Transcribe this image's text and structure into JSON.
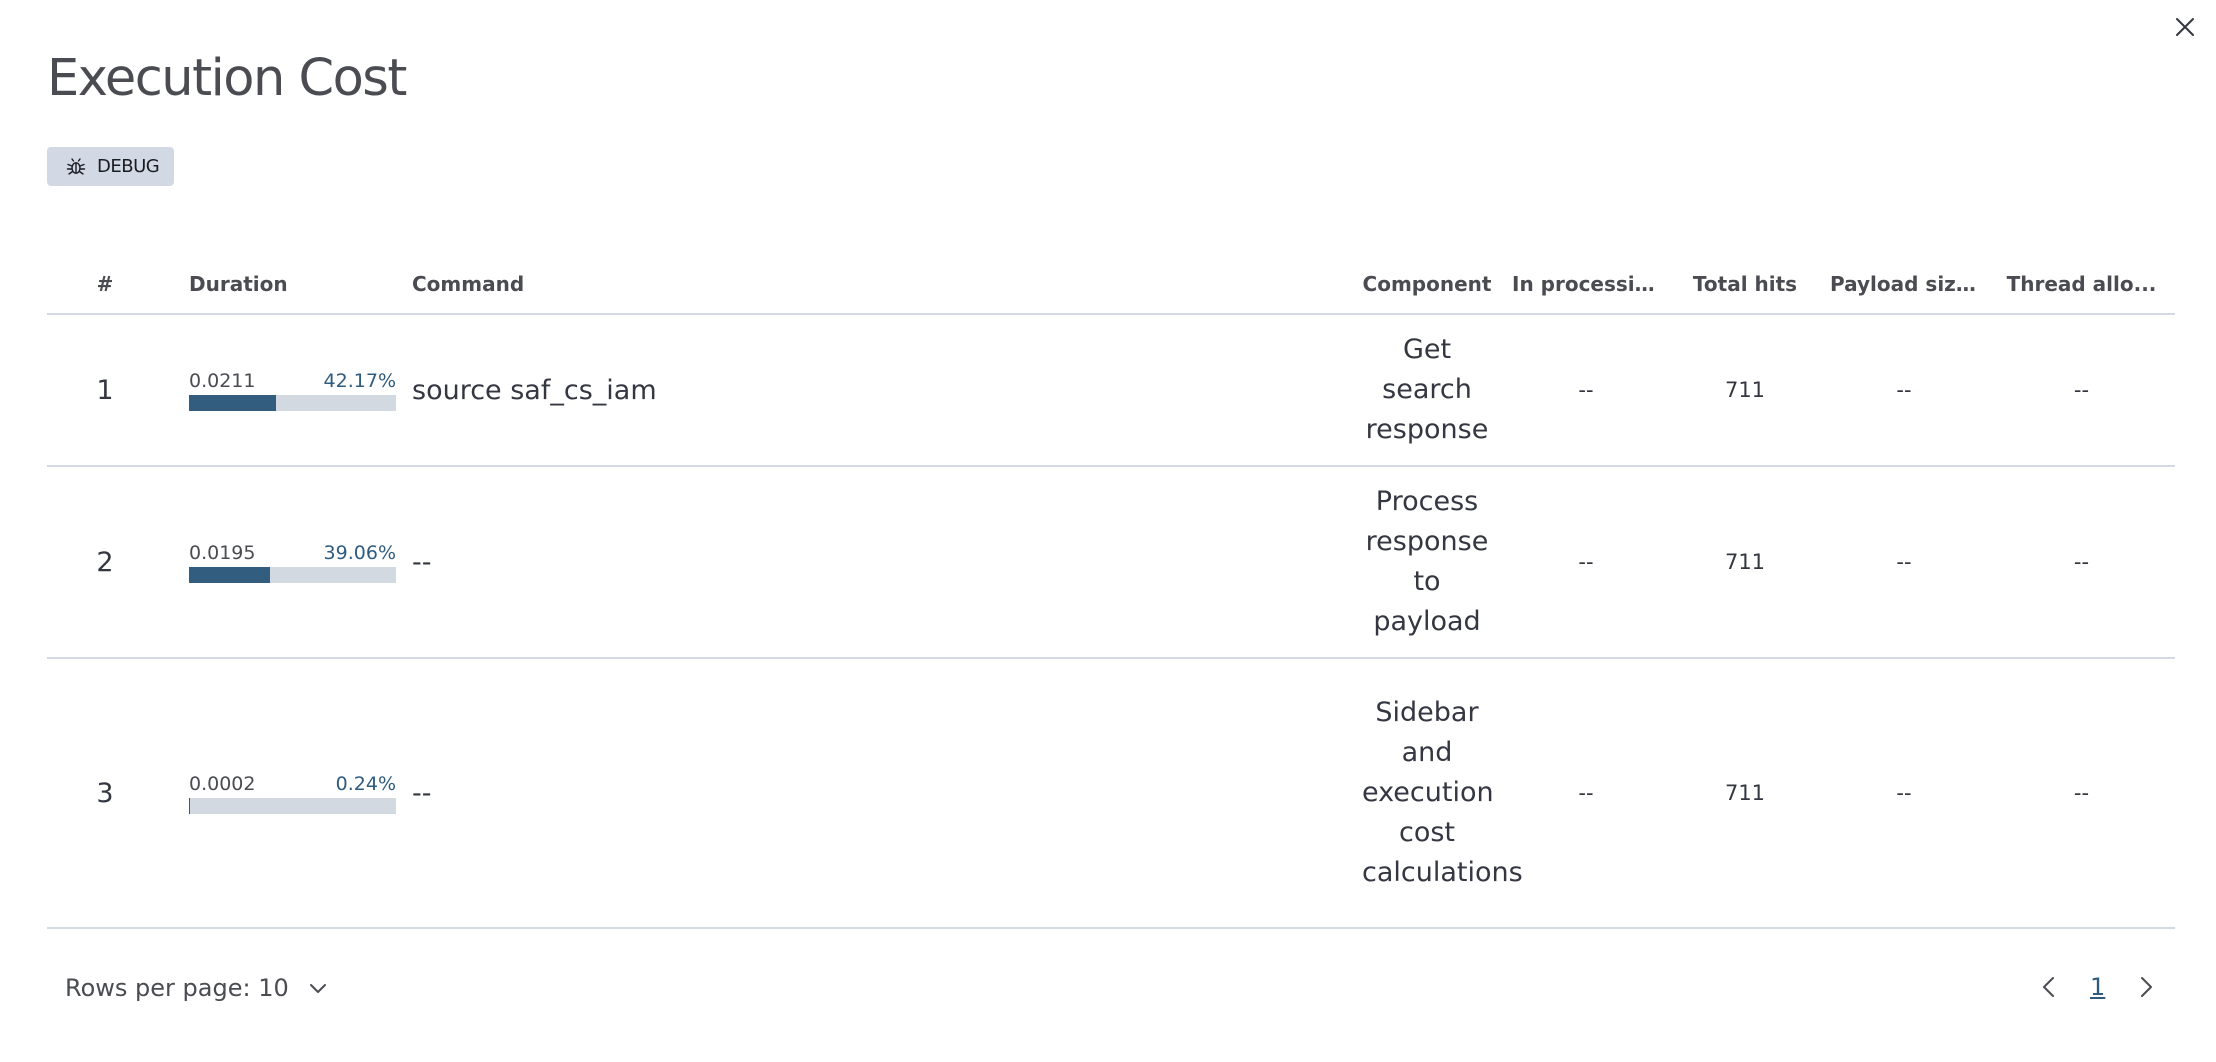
{
  "modal": {
    "title": "Execution Cost",
    "close_icon": "close-icon",
    "debug_button": {
      "label": "DEBUG",
      "icon": "bug-icon"
    }
  },
  "table": {
    "headers": {
      "num": "#",
      "duration": "Duration",
      "command": "Command",
      "component": "Component",
      "in_processing": "In processing",
      "total_hits": "Total hits",
      "payload_size": "Payload siz...",
      "thread_alloc": "Thread allo..."
    },
    "rows": [
      {
        "num": "1",
        "duration": "0.0211",
        "percent": "42.17%",
        "fraction": 0.4217,
        "command": "source saf_cs_iam",
        "component": "Get search response",
        "in_processing": "--",
        "total_hits": "711",
        "payload_size": "--",
        "thread_alloc": "--"
      },
      {
        "num": "2",
        "duration": "0.0195",
        "percent": "39.06%",
        "fraction": 0.3906,
        "command": "--",
        "component": "Process response to payload",
        "in_processing": "--",
        "total_hits": "711",
        "payload_size": "--",
        "thread_alloc": "--"
      },
      {
        "num": "3",
        "duration": "0.0002",
        "percent": "0.24%",
        "fraction": 0.0024,
        "command": "--",
        "component": "Sidebar and execution cost calculations",
        "in_processing": "--",
        "total_hits": "711",
        "payload_size": "--",
        "thread_alloc": "--"
      }
    ]
  },
  "pagination": {
    "rows_per_page_label": "Rows per page: 10",
    "current_page": "1",
    "prev_icon": "chevron-left-icon",
    "next_icon": "chevron-right-icon"
  },
  "colors": {
    "bar_fill": "#335d7e",
    "bar_track": "#d3d9e0",
    "accent": "#2f5c7e"
  }
}
